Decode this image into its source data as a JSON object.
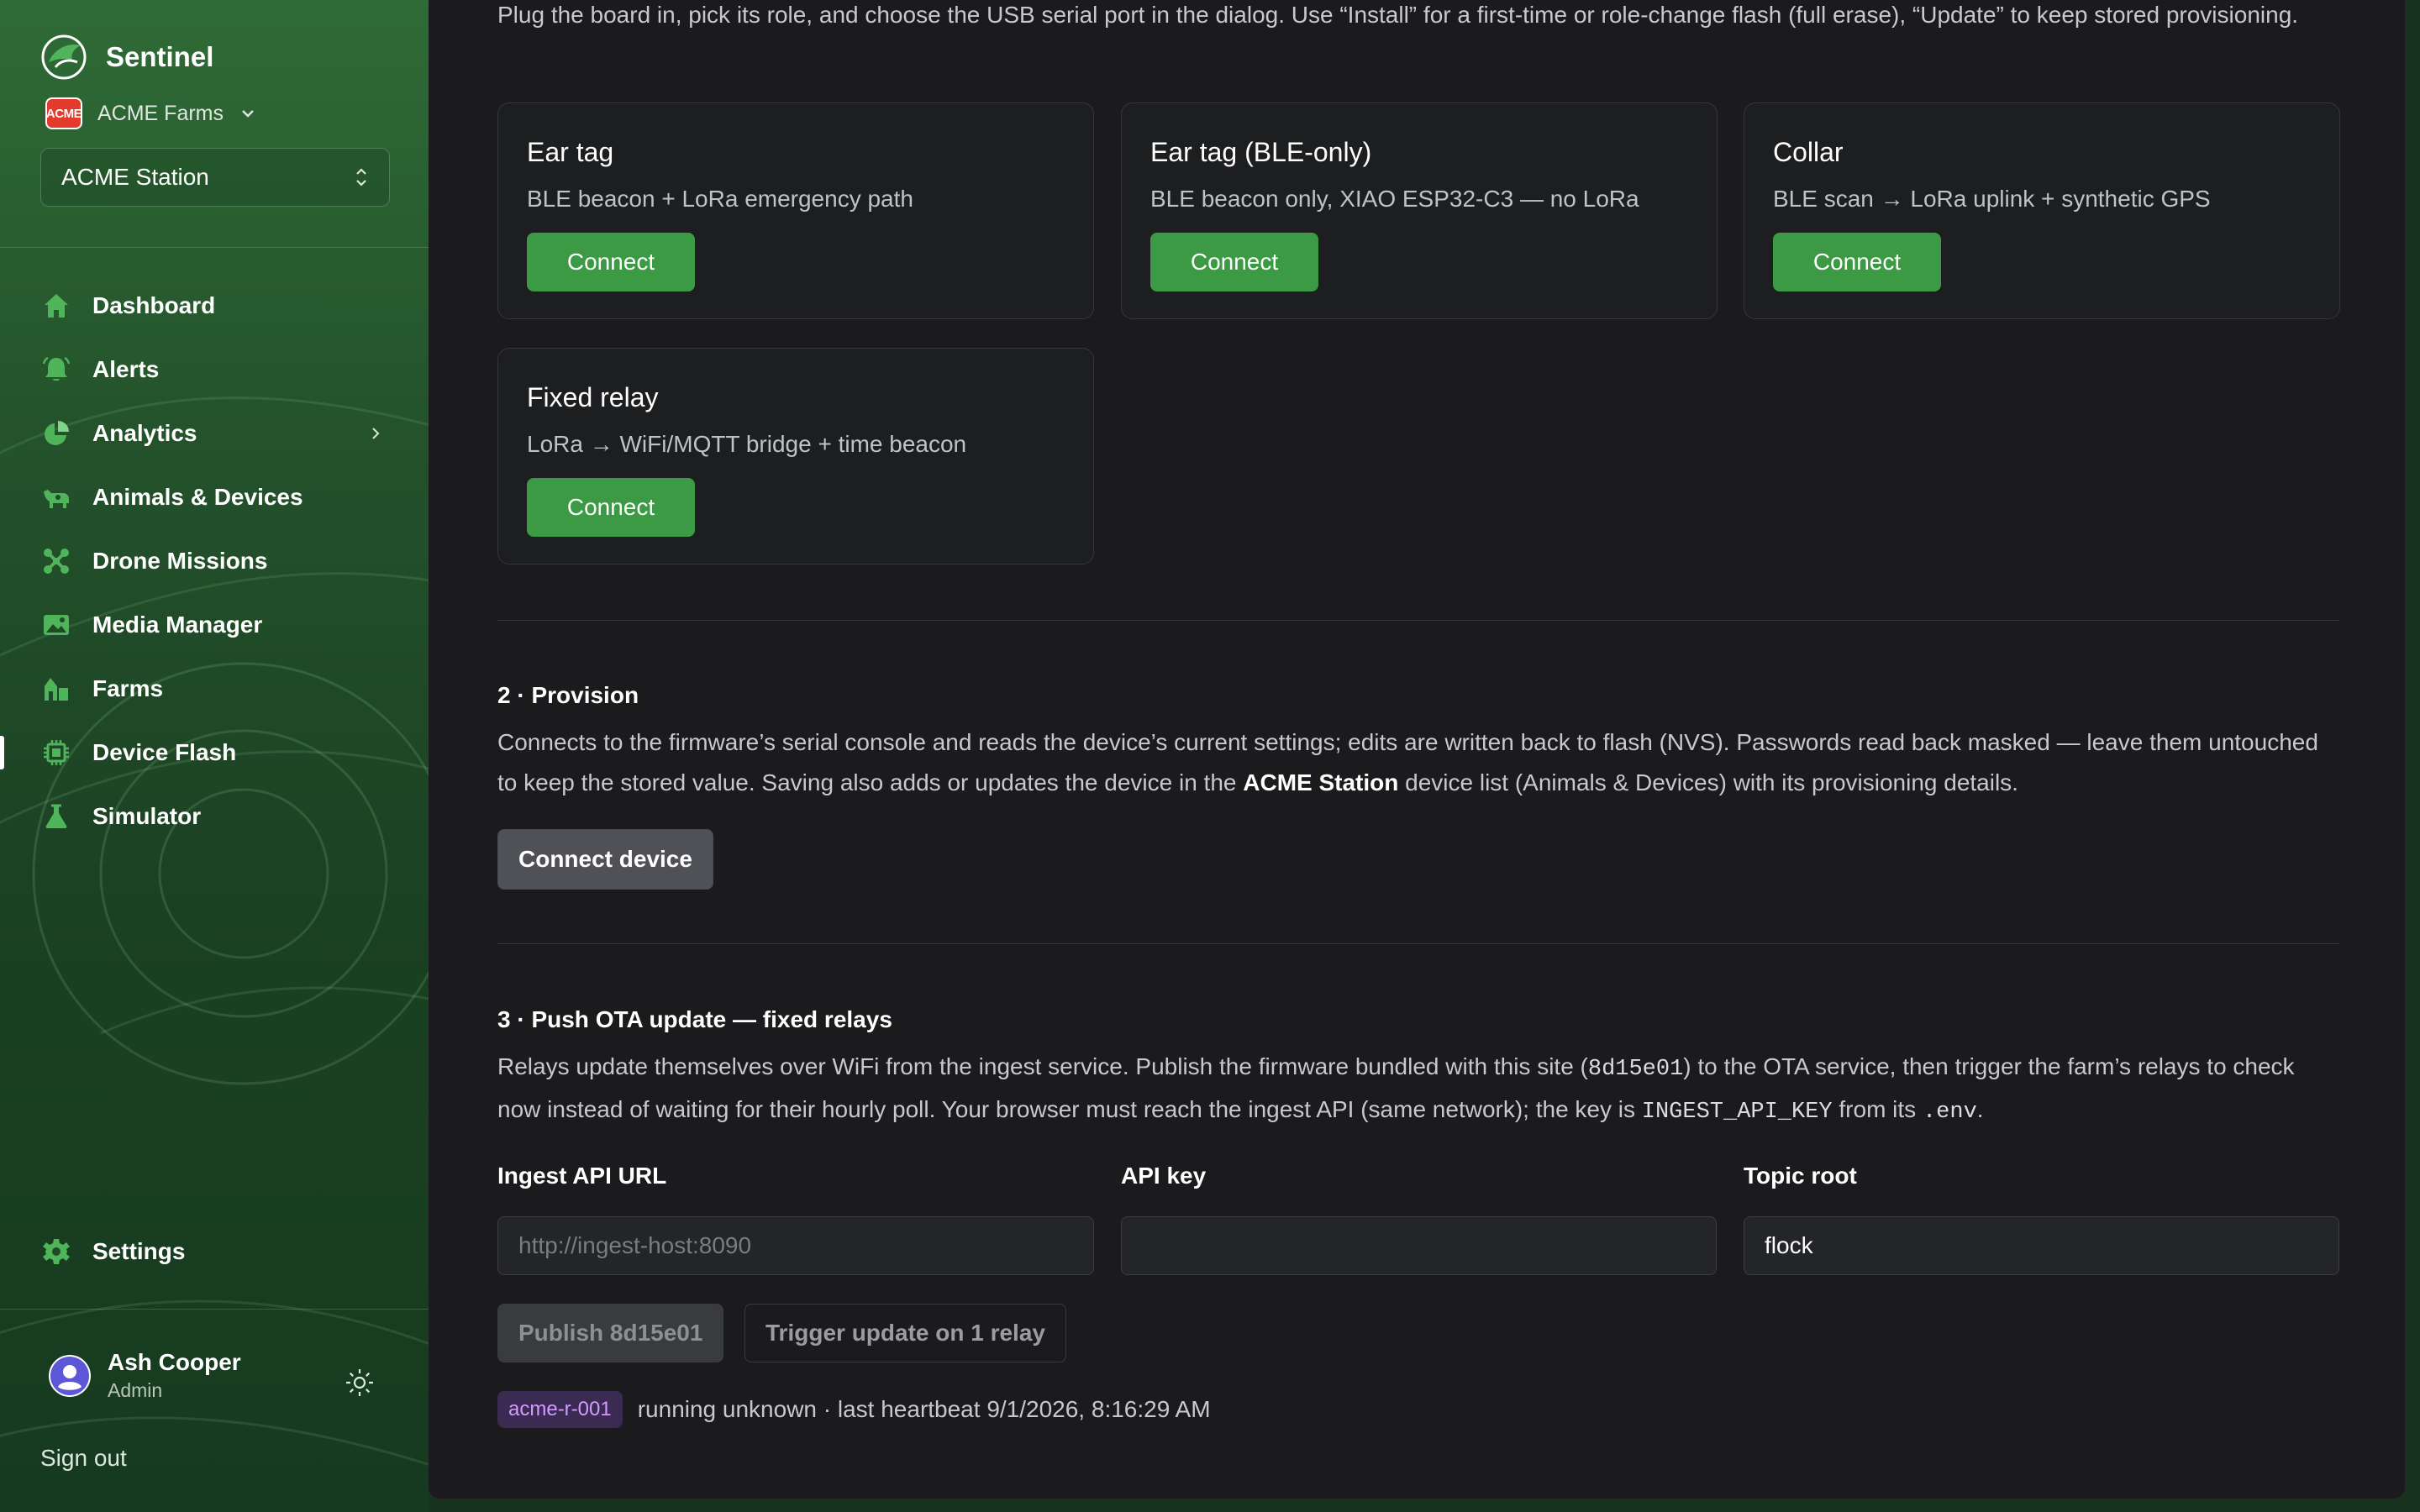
{
  "sidebar": {
    "brand": "Sentinel",
    "org": {
      "logo_text": "ACME",
      "name": "ACME Farms"
    },
    "station": "ACME Station",
    "items": [
      {
        "label": "Dashboard",
        "icon": "home-icon"
      },
      {
        "label": "Alerts",
        "icon": "bell-icon"
      },
      {
        "label": "Analytics",
        "icon": "pie-chart-icon"
      },
      {
        "label": "Animals & Devices",
        "icon": "cow-icon"
      },
      {
        "label": "Drone Missions",
        "icon": "drone-icon"
      },
      {
        "label": "Media Manager",
        "icon": "image-icon"
      },
      {
        "label": "Farms",
        "icon": "barn-icon"
      },
      {
        "label": "Device Flash",
        "icon": "chip-icon"
      },
      {
        "label": "Simulator",
        "icon": "flask-icon"
      }
    ],
    "active_item": "Device Flash",
    "settings": "Settings",
    "user": {
      "name": "Ash Cooper",
      "role": "Admin"
    },
    "sign_out": "Sign out"
  },
  "flash": {
    "intro": "Plug the board in, pick its role, and choose the USB serial port in the dialog. Use “Install” for a first-time or role-change flash (full erase), “Update” to keep stored provisioning.",
    "cards": [
      {
        "title": "Ear tag",
        "desc": "BLE beacon + LoRa emergency path",
        "button": "Connect"
      },
      {
        "title": "Ear tag (BLE-only)",
        "desc": "BLE beacon only, XIAO ESP32-C3 — no LoRa",
        "button": "Connect"
      },
      {
        "title": "Collar",
        "desc": "BLE scan → LoRa uplink + synthetic GPS",
        "button": "Connect"
      },
      {
        "title": "Fixed relay",
        "desc": "LoRa → WiFi/MQTT bridge + time beacon",
        "button": "Connect"
      }
    ]
  },
  "provision": {
    "title": "2 · Provision",
    "desc_part1": "Connects to the firmware’s serial console and reads the device’s current settings; edits are written back to flash (NVS). Passwords read back masked — leave them untouched to keep the stored value. Saving also adds or updates the device in the ",
    "desc_station": "ACME Station",
    "desc_part2": " device list (Animals & Devices) with its provisioning details.",
    "button": "Connect device"
  },
  "ota": {
    "title": "3 · Push OTA update — fixed relays",
    "desc_part1": "Relays update themselves over WiFi from the ingest service. Publish the firmware bundled with this site (",
    "desc_code1": "8d15e01",
    "desc_part2": ") to the OTA service, then trigger the farm’s relays to check now instead of waiting for their hourly poll. Your browser must reach the ingest API (same network); the key is ",
    "desc_code2": "INGEST_API_KEY",
    "desc_part3": " from its ",
    "desc_code3": ".env",
    "desc_part4": ".",
    "fields": {
      "url_label": "Ingest API URL",
      "url_placeholder": "http://ingest-host:8090",
      "url_value": "",
      "key_label": "API key",
      "key_value": "",
      "topic_label": "Topic root",
      "topic_value": "flock"
    },
    "publish_button": "Publish 8d15e01",
    "trigger_button": "Trigger update on 1 relay",
    "relay": {
      "id": "acme-r-001",
      "status": "running unknown · last heartbeat 9/1/2026, 8:16:29 AM"
    }
  }
}
